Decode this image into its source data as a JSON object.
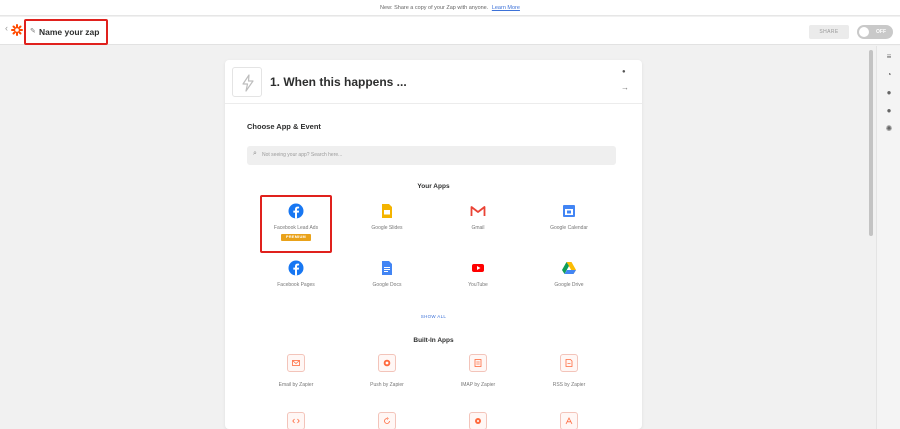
{
  "banner": {
    "text": "New: Share a copy of your Zap with anyone.",
    "link": "Learn More"
  },
  "topbar": {
    "zap_name": "Name your zap",
    "share_label": "SHARE",
    "toggle_label": "OFF"
  },
  "step": {
    "title": "1. When this happens ..."
  },
  "choose": {
    "label": "Choose App & Event",
    "search_placeholder": "Not seeing your app? Search here..."
  },
  "your_apps": {
    "title": "Your Apps",
    "items": [
      {
        "label": "Facebook Lead Ads",
        "badge": "PREMIUM",
        "icon": "facebook-icon"
      },
      {
        "label": "Google Slides",
        "icon": "google-slides-icon"
      },
      {
        "label": "Gmail",
        "icon": "gmail-icon"
      },
      {
        "label": "Google Calendar",
        "icon": "google-calendar-icon"
      },
      {
        "label": "Facebook Pages",
        "icon": "facebook-icon"
      },
      {
        "label": "Google Docs",
        "icon": "google-docs-icon"
      },
      {
        "label": "YouTube",
        "icon": "youtube-icon"
      },
      {
        "label": "Google Drive",
        "icon": "google-drive-icon"
      }
    ],
    "show_all": "SHOW ALL"
  },
  "built_in": {
    "title": "Built-In Apps",
    "items": [
      {
        "label": "Email by Zapier",
        "icon": "email-icon"
      },
      {
        "label": "Push by Zapier",
        "icon": "push-icon"
      },
      {
        "label": "IMAP by Zapier",
        "icon": "imap-icon"
      },
      {
        "label": "RSS by Zapier",
        "icon": "rss-icon"
      }
    ]
  },
  "colors": {
    "highlight": "#e0211d",
    "zapier_orange": "#ff4a00",
    "facebook_blue": "#1877f2",
    "premium": "#e9a21a",
    "link": "#3d72d8"
  }
}
